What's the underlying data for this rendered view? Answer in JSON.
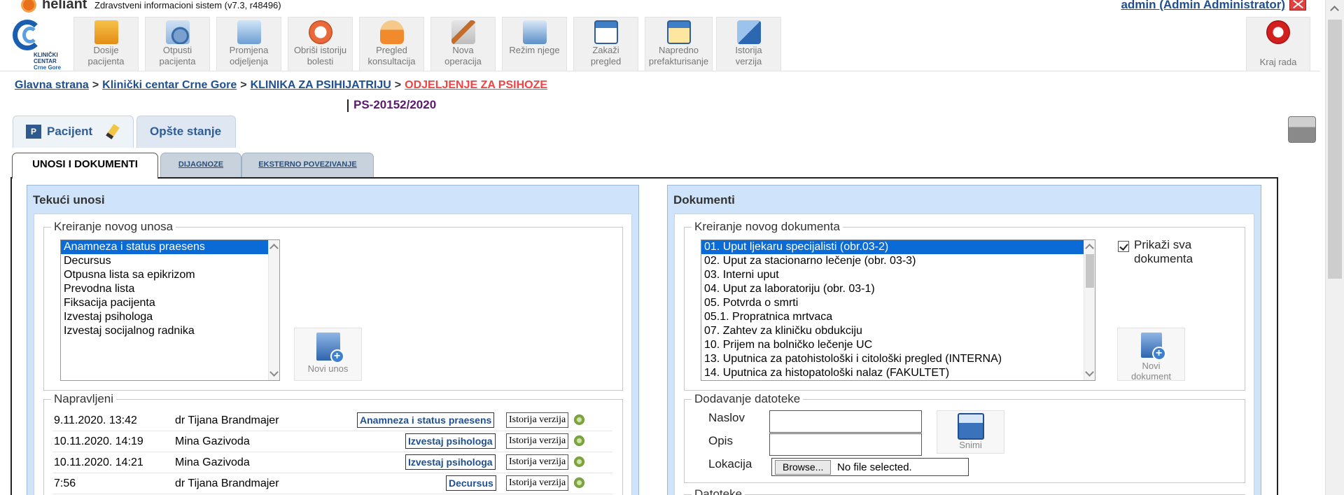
{
  "app": {
    "brand": "heliant",
    "system_title": "Zdravstveni informacioni sistem (v7.3, r48496)",
    "user": "admin (Admin Administrator)",
    "logo_text": [
      "KLINIČKI",
      "CENTAR",
      "Crne Gore"
    ]
  },
  "toolbar": [
    {
      "label1": "Dosije",
      "label2": "pacijenta",
      "icon": "folder-icon"
    },
    {
      "label1": "Otpusti",
      "label2": "pacijenta",
      "icon": "discharge-icon"
    },
    {
      "label1": "Promjena",
      "label2": "odjeljenja",
      "icon": "transfer-icon"
    },
    {
      "label1": "Obriši istoriju",
      "label2": "bolesti",
      "icon": "delete-history-icon"
    },
    {
      "label1": "Pregled",
      "label2": "konsultacija",
      "icon": "doctor-icon"
    },
    {
      "label1": "Nova",
      "label2": "operacija",
      "icon": "scalpel-icon"
    },
    {
      "label1": "Režim njege",
      "label2": "",
      "icon": "care-icon"
    },
    {
      "label1": "Zakaži",
      "label2": "pregled",
      "icon": "calendar-icon"
    },
    {
      "label1": "Napredno",
      "label2": "prefakturisanje",
      "icon": "billing-calendar-icon"
    },
    {
      "label1": "Istorija",
      "label2": "verzija",
      "icon": "versions-icon"
    }
  ],
  "kraj_rada": "Kraj rada",
  "breadcrumb": {
    "items": [
      "Glavna strana",
      "Klinički centar Crne Gore",
      "KLINIKA ZA PSIHIJATRIJU"
    ],
    "current": "ODJELJENJE ZA PSIHOZE",
    "separator": ">"
  },
  "case_id": "PS-20152/2020",
  "patient_tabs": {
    "badge": "P",
    "pacijent": "Pacijent",
    "opste_stanje": "Opšte stanje"
  },
  "section_tabs": [
    "UNOSI I DOKUMENTI",
    "DIJAGNOZE",
    "EKSTERNO POVEZIVANJE"
  ],
  "left_panel": {
    "title": "Tekući unosi",
    "create_legend": "Kreiranje novog unosa",
    "entry_types": [
      "Anamneza i status praesens",
      "Decursus",
      "Otpusna lista sa epikrizom",
      "Prevodna lista",
      "Fiksacija pacijenta",
      "Izvestaj psihologa",
      "Izvestaj socijalnog radnika"
    ],
    "new_entry_button": "Novi unos",
    "made_legend": "Napravljeni",
    "history_label": "Istorija verzija",
    "entries": [
      {
        "time": "9.11.2020. 13:42",
        "doctor": "dr Tijana Brandmajer",
        "type": "Anamneza i status praesens"
      },
      {
        "time": "10.11.2020. 14:19",
        "doctor": "Mina Gazivoda",
        "type": "Izvestaj psihologa"
      },
      {
        "time": "10.11.2020. 14:21",
        "doctor": "Mina Gazivoda",
        "type": "Izvestaj psihologa"
      },
      {
        "time": "7:56",
        "doctor": "dr Tijana Brandmajer",
        "type": "Decursus"
      }
    ]
  },
  "right_panel": {
    "title": "Dokumenti",
    "create_legend": "Kreiranje novog dokumenta",
    "documents": [
      "01. Uput ljekaru specijalisti (obr.03-2)",
      "02. Uput za stacionarno lečenje (obr. 03-3)",
      "03. Interni uput",
      "04. Uput za laboratoriju (obr. 03-1)",
      "05. Potvrda o smrti",
      "05.1. Propratnica mrtvaca",
      "07. Zahtev za kliničku obdukciju",
      "10. Prijem na bolničko lečenje UC",
      "13. Uputnica za patohistološki i citološki pregled (INTERNA)",
      "14. Uputnica za histopatološki nalaz (FAKULTET)"
    ],
    "show_all_label": "Prikaži sva dokumenta",
    "show_all_checked": true,
    "new_document_button": [
      "Novi",
      "dokument"
    ],
    "add_file_legend": "Dodavanje datoteke",
    "naslov_label": "Naslov",
    "opis_label": "Opis",
    "lokacija_label": "Lokacija",
    "browse_label": "Browse...",
    "no_file_label": "No file selected.",
    "save_button": "Snimi",
    "files_legend": "Datoteke"
  }
}
